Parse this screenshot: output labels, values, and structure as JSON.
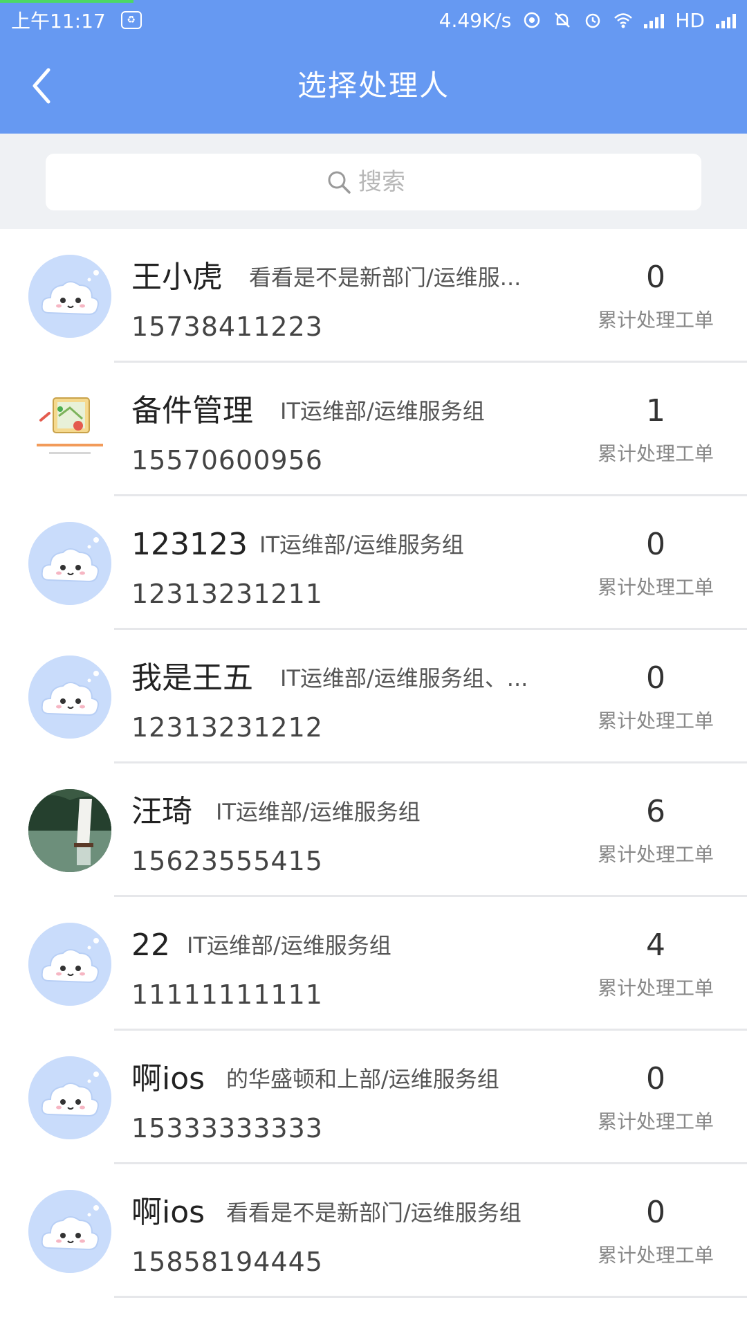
{
  "status_bar": {
    "time": "上午11:17",
    "cloud_label": "♻",
    "net_speed": "4.49K/s",
    "network_type": "HD"
  },
  "nav": {
    "title": "选择处理人",
    "back_icon": "chevron-left-icon"
  },
  "search": {
    "placeholder": "搜索",
    "icon": "search-icon"
  },
  "count_caption": "累计处理工单",
  "colors": {
    "header": "#6699f2",
    "avatar_bg": "#c9dcfb",
    "progress": "#4cd964"
  },
  "users": [
    {
      "name": "王小虎",
      "dept": "看看是不是新部门/运维服...",
      "phone": "15738411223",
      "count": "0",
      "avatar": "cloud-avatar"
    },
    {
      "name": "备件管理",
      "dept": "IT运维部/运维服务组",
      "phone": "15570600956",
      "count": "1",
      "avatar": "map-avatar"
    },
    {
      "name": "123123",
      "dept": "IT运维部/运维服务组",
      "phone": "12313231211",
      "count": "0",
      "avatar": "cloud-avatar"
    },
    {
      "name": "我是王五",
      "dept": "IT运维部/运维服务组、...",
      "phone": "12313231212",
      "count": "0",
      "avatar": "cloud-avatar"
    },
    {
      "name": "汪琦",
      "dept": "IT运维部/运维服务组",
      "phone": "15623555415",
      "count": "6",
      "avatar": "photo-avatar"
    },
    {
      "name": "22",
      "dept": "IT运维部/运维服务组",
      "phone": "11111111111",
      "count": "4",
      "avatar": "cloud-avatar"
    },
    {
      "name": "啊ios",
      "dept": "的华盛顿和上部/运维服务组",
      "phone": "15333333333",
      "count": "0",
      "avatar": "cloud-avatar"
    },
    {
      "name": "啊ios",
      "dept": "看看是不是新部门/运维服务组",
      "phone": "15858194445",
      "count": "0",
      "avatar": "cloud-avatar"
    }
  ]
}
